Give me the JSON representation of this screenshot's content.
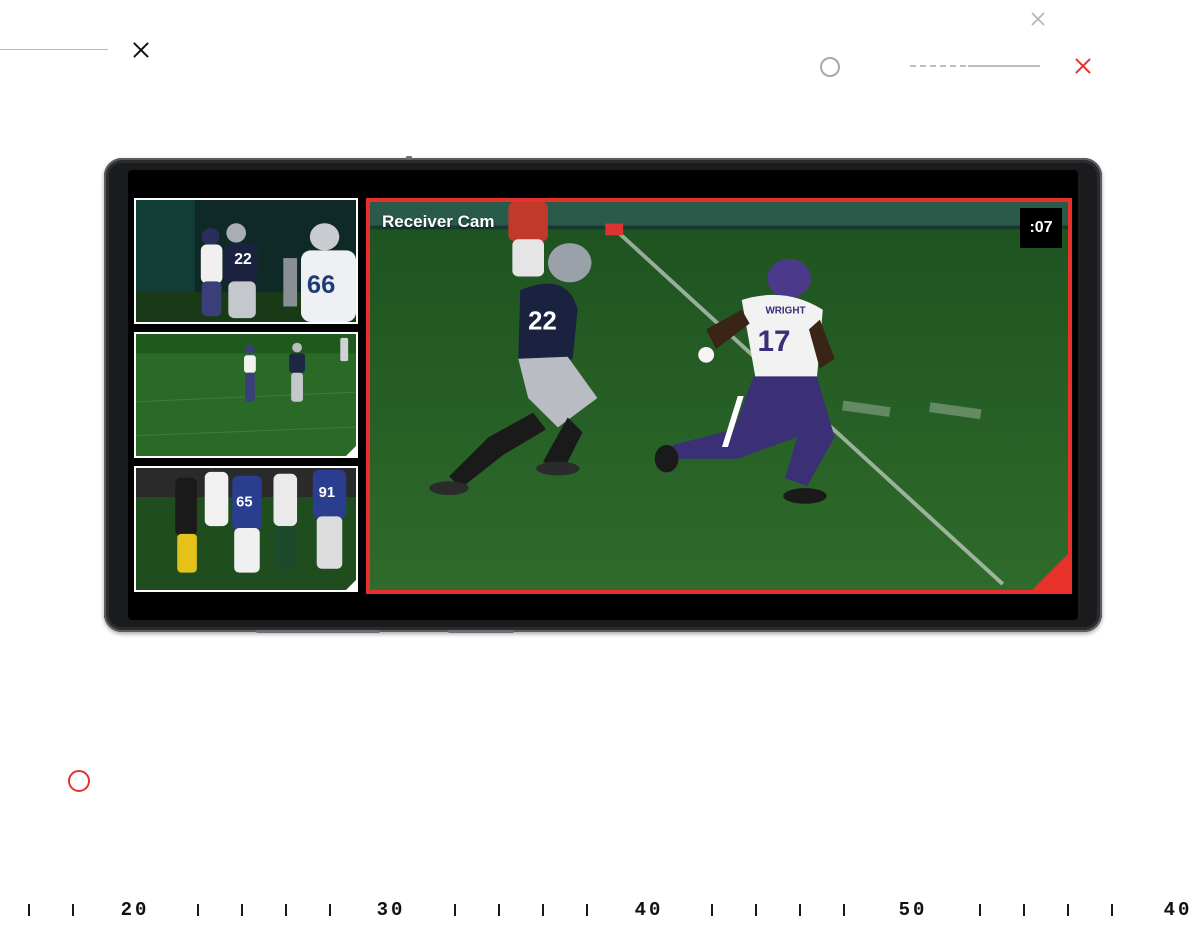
{
  "main_feed": {
    "label": "Receiver Cam",
    "timer": ":07",
    "accent_color": "#e8312a"
  },
  "thumbnails": [
    {
      "name": "thumbnail-feed-1"
    },
    {
      "name": "thumbnail-feed-2"
    },
    {
      "name": "thumbnail-feed-3"
    }
  ],
  "jerseys": {
    "main_defender": "22",
    "main_receiver": "17",
    "main_receiver_name": "WRIGHT",
    "thumb1_a": "22",
    "thumb1_b": "66",
    "thumb3_a": "65",
    "thumb3_b": "91"
  },
  "ruler": {
    "labels": [
      "20",
      "30",
      "40",
      "50",
      "40"
    ]
  },
  "decor": {
    "icons": [
      "close-icon",
      "circle-icon",
      "close-icon-red",
      "close-icon-gray",
      "circle-icon-red"
    ],
    "red": "#e8312a",
    "gray": "#b5b5b5"
  }
}
